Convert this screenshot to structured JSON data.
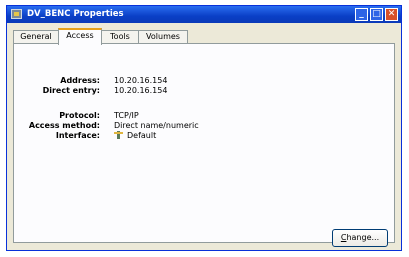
{
  "window": {
    "title": "DV_BENC Properties"
  },
  "titlebar_buttons": {
    "minimize": "_",
    "maximize": "□",
    "close": "✕"
  },
  "tabs": [
    {
      "label": "General",
      "active": false
    },
    {
      "label": "Access",
      "active": true
    },
    {
      "label": "Tools",
      "active": false
    },
    {
      "label": "Volumes",
      "active": false
    }
  ],
  "fields": {
    "address": {
      "label": "Address:",
      "value": "10.20.16.154"
    },
    "direct_entry": {
      "label": "Direct entry:",
      "value": "10.20.16.154"
    },
    "protocol": {
      "label": "Protocol:",
      "value": "TCP/IP"
    },
    "access_method": {
      "label": "Access method:",
      "value": "Direct name/numeric"
    },
    "interface": {
      "label": "Interface:",
      "value": "Default",
      "icon": "network-interface-icon"
    }
  },
  "buttons": {
    "change_mnemonic": "C",
    "change_rest": "hange..."
  },
  "colors": {
    "titlebar": "#0a3fc6",
    "active_tab_accent": "#e6a11a",
    "dialog_bg": "#ece9d8"
  }
}
